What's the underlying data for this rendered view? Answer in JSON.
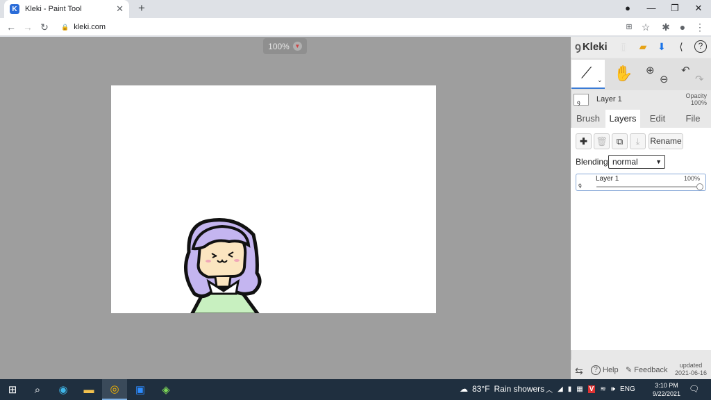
{
  "browser": {
    "tab_title": "Kleki - Paint Tool",
    "tab_close": "✕",
    "new_tab": "+",
    "url": "kleki.com",
    "window_min": "—",
    "window_restore": "❐",
    "window_close": "✕"
  },
  "canvas": {
    "zoom_label": "100%"
  },
  "panel": {
    "logo": "Kleki",
    "current_layer": "Layer 1",
    "opacity_label": "Opacity",
    "opacity_value": "100%",
    "tabs": [
      "Brush",
      "Layers",
      "Edit",
      "File"
    ],
    "active_tab": "Layers",
    "rename_label": "Rename",
    "blending_label": "Blending",
    "blending_value": "normal",
    "layer_thumb_glyph": "ꝯ",
    "layers": [
      {
        "name": "Layer 1",
        "opacity": "100%"
      }
    ],
    "footer": {
      "help": "Help",
      "feedback": "Feedback",
      "updated_label": "updated",
      "updated_date": "2021-06-16"
    }
  },
  "taskbar": {
    "weather_temp": "83°F",
    "weather_text": "Rain showers",
    "lang": "ENG",
    "time": "3:10 PM",
    "date": "9/22/2021"
  },
  "colors": {
    "hair": "#c4b5f0",
    "skin": "#fbe5c0",
    "shirt": "#c8f0c0",
    "accent": "#1a73e8"
  }
}
